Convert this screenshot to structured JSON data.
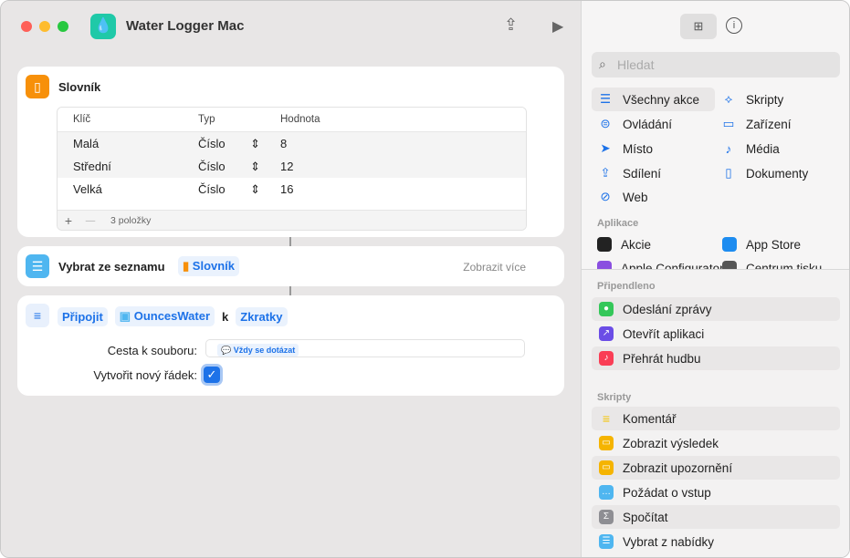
{
  "window": {
    "title": "Water Logger Mac"
  },
  "dictionary": {
    "title": "Slovník",
    "headers": [
      "Klíč",
      "Typ",
      "Hodnota"
    ],
    "rows": [
      {
        "key": "Malá",
        "type": "Číslo",
        "value": "8"
      },
      {
        "key": "Střední",
        "type": "Číslo",
        "value": "12"
      },
      {
        "key": "Velká",
        "type": "Číslo",
        "value": "16"
      }
    ],
    "count": "3 položky",
    "add": "+",
    "remove": "—"
  },
  "choose": {
    "title": "Vybrat ze seznamu",
    "token": "Slovník",
    "more": "Zobrazit více"
  },
  "append": {
    "verb": "Připojit",
    "variable": "OuncesWater",
    "k": "k",
    "target": "Zkratky",
    "path_label": "Cesta k souboru:",
    "path_value": "Vždy se dotázat",
    "newline_label": "Vytvořit nový řádek:",
    "newline_checked": true
  },
  "sidebar": {
    "search_placeholder": "Hledat",
    "categories": [
      {
        "label": "Všechny akce",
        "icon": "☰"
      },
      {
        "label": "Skripty",
        "icon": "⟡"
      },
      {
        "label": "Ovládání",
        "icon": "⊜"
      },
      {
        "label": "Zařízení",
        "icon": "▭"
      },
      {
        "label": "Místo",
        "icon": "➤"
      },
      {
        "label": "Média",
        "icon": "♪"
      },
      {
        "label": "Sdílení",
        "icon": "⇪"
      },
      {
        "label": "Dokumenty",
        "icon": "▯"
      },
      {
        "label": "Web",
        "icon": "⊘"
      }
    ],
    "apps_heading": "Aplikace",
    "apps": [
      "Akcie",
      "App Store",
      "Apple Configurator",
      "Centrum tisku"
    ],
    "pinned_heading": "Připendleno",
    "pinned": [
      {
        "label": "Odeslání zprávy",
        "color": "#34c759"
      },
      {
        "label": "Otevřít aplikaci",
        "color": "#6b4de6"
      },
      {
        "label": "Přehrát hudbu",
        "color": "#fa3d55"
      }
    ],
    "scripts_heading": "Skripty",
    "scripts": [
      {
        "label": "Komentář",
        "color": "#f5d04a"
      },
      {
        "label": "Zobrazit výsledek",
        "color": "#f5b400"
      },
      {
        "label": "Zobrazit upozornění",
        "color": "#f5b400"
      },
      {
        "label": "Požádat o vstup",
        "color": "#4fb6f0"
      },
      {
        "label": "Spočítat",
        "color": "#8e8e93"
      },
      {
        "label": "Vybrat z nabídky",
        "color": "#4fb6f0"
      }
    ]
  }
}
